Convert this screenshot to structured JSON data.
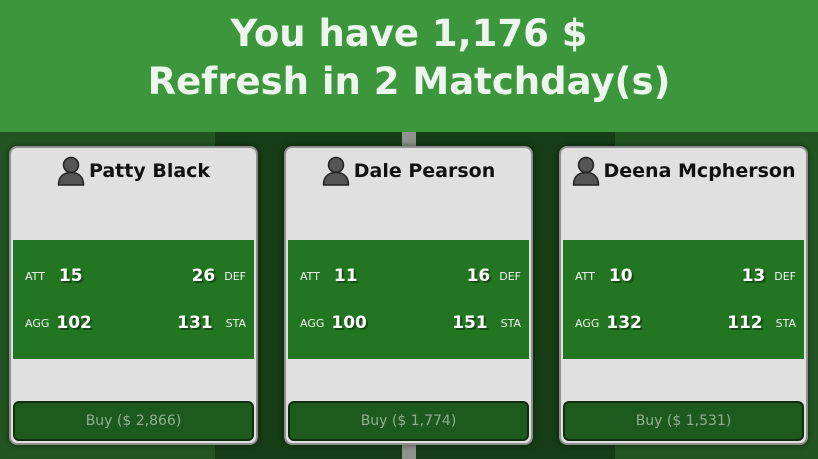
{
  "header": {
    "money_line": "You have 1,176 $",
    "refresh_line": "Refresh in 2 Matchday(s)"
  },
  "stat_labels": {
    "att": "ATT",
    "def": "DEF",
    "agg": "AGG",
    "sta": "STA"
  },
  "players": [
    {
      "name": "Patty Black",
      "att": "15",
      "def": "26",
      "agg": "102",
      "sta": "131",
      "buy_label": "Buy ($ 2,866)"
    },
    {
      "name": "Dale Pearson",
      "att": "11",
      "def": "16",
      "agg": "100",
      "sta": "151",
      "buy_label": "Buy ($ 1,774)"
    },
    {
      "name": "Deena Mcpherson",
      "att": "10",
      "def": "13",
      "agg": "132",
      "sta": "112",
      "buy_label": "Buy ($ 1,531)"
    }
  ],
  "colors": {
    "header_bg": "#3c963c",
    "stats_bg": "#227622",
    "button_bg": "#1d5a1d",
    "card_bg": "#e0e0e0"
  },
  "icons": {
    "avatar": "person-silhouette-icon"
  }
}
